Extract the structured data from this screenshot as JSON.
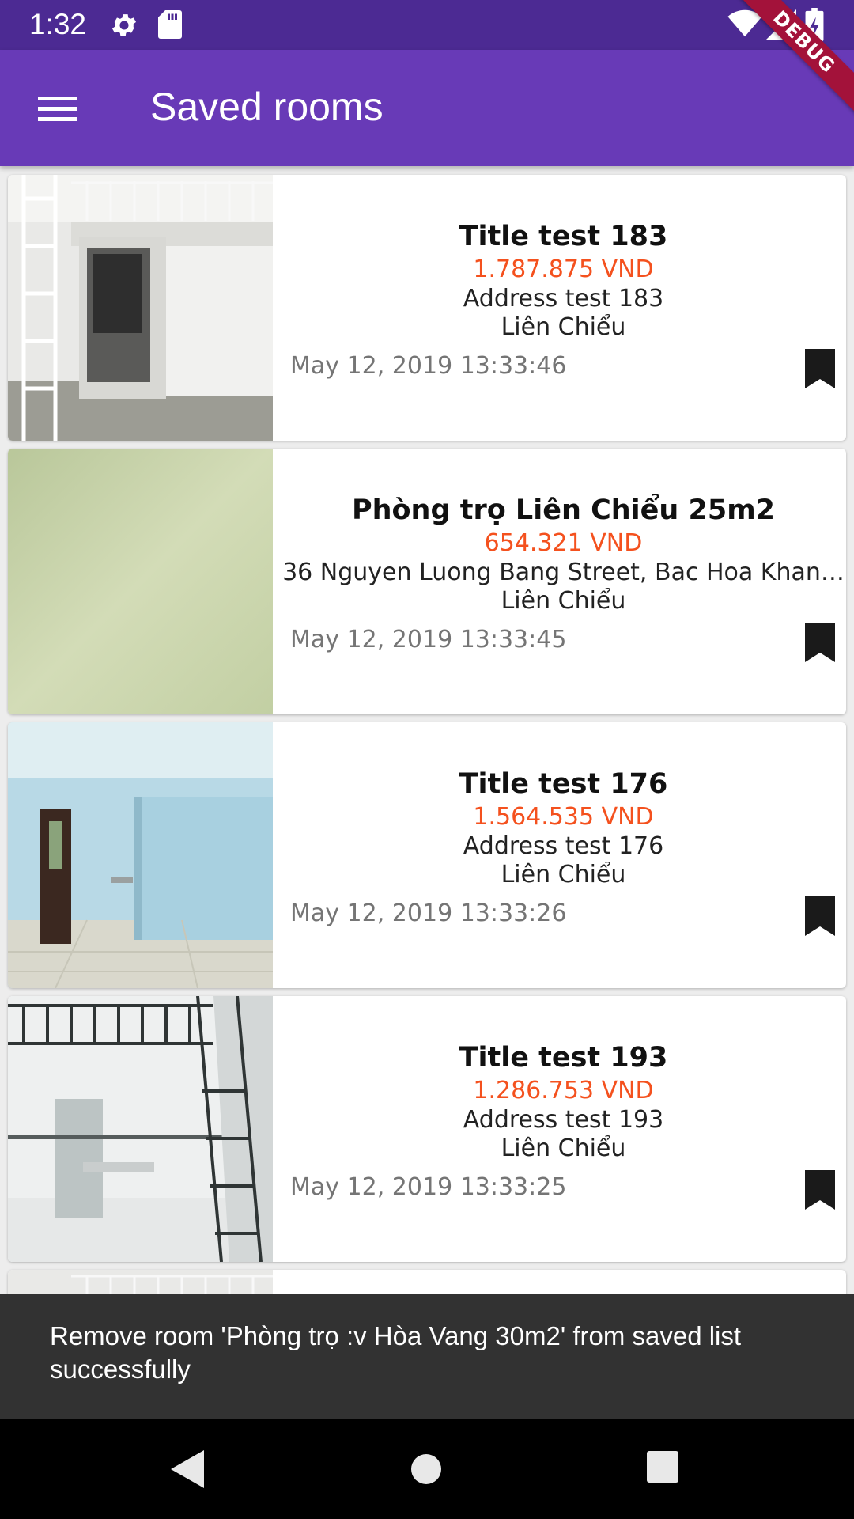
{
  "status_bar": {
    "time": "1:32",
    "icons": [
      "gear-icon",
      "sd-card-icon",
      "wifi-icon",
      "signal-icon",
      "battery-icon"
    ]
  },
  "debug_banner": "DEBUG",
  "app_bar": {
    "menu_icon": "hamburger-menu-icon",
    "title": "Saved rooms"
  },
  "rooms": [
    {
      "title": "Title test 183",
      "price": "1.787.875 VND",
      "address": "Address test 183",
      "district": "Liên Chiểu",
      "date": "May 12, 2019 13:33:46",
      "bookmark_icon": "bookmark-filled-icon"
    },
    {
      "title": "Phòng trọ Liên Chiểu 25m2",
      "price": "654.321 VND",
      "address": "36 Nguyen Luong Bang Street, Bac Hoa Khan…",
      "district": "Liên Chiểu",
      "date": "May 12, 2019 13:33:45",
      "bookmark_icon": "bookmark-filled-icon"
    },
    {
      "title": "Title test 176",
      "price": "1.564.535 VND",
      "address": "Address test 176",
      "district": "Liên Chiểu",
      "date": "May 12, 2019 13:33:26",
      "bookmark_icon": "bookmark-filled-icon"
    },
    {
      "title": "Title test 193",
      "price": "1.286.753 VND",
      "address": "Address test 193",
      "district": "Liên Chiểu",
      "date": "May 12, 2019 13:33:25",
      "bookmark_icon": "bookmark-filled-icon"
    }
  ],
  "snackbar": {
    "message": "Remove room 'Phòng trọ :v Hòa Vang 30m2' from saved list successfully"
  },
  "nav_bar": {
    "icons": [
      "back-icon",
      "home-icon",
      "recents-icon"
    ]
  },
  "colors": {
    "status_bar": "#4c2a93",
    "app_bar": "#683ab7",
    "price": "#f4511e",
    "snackbar": "#323232",
    "debug_banner": "#a3123a"
  }
}
